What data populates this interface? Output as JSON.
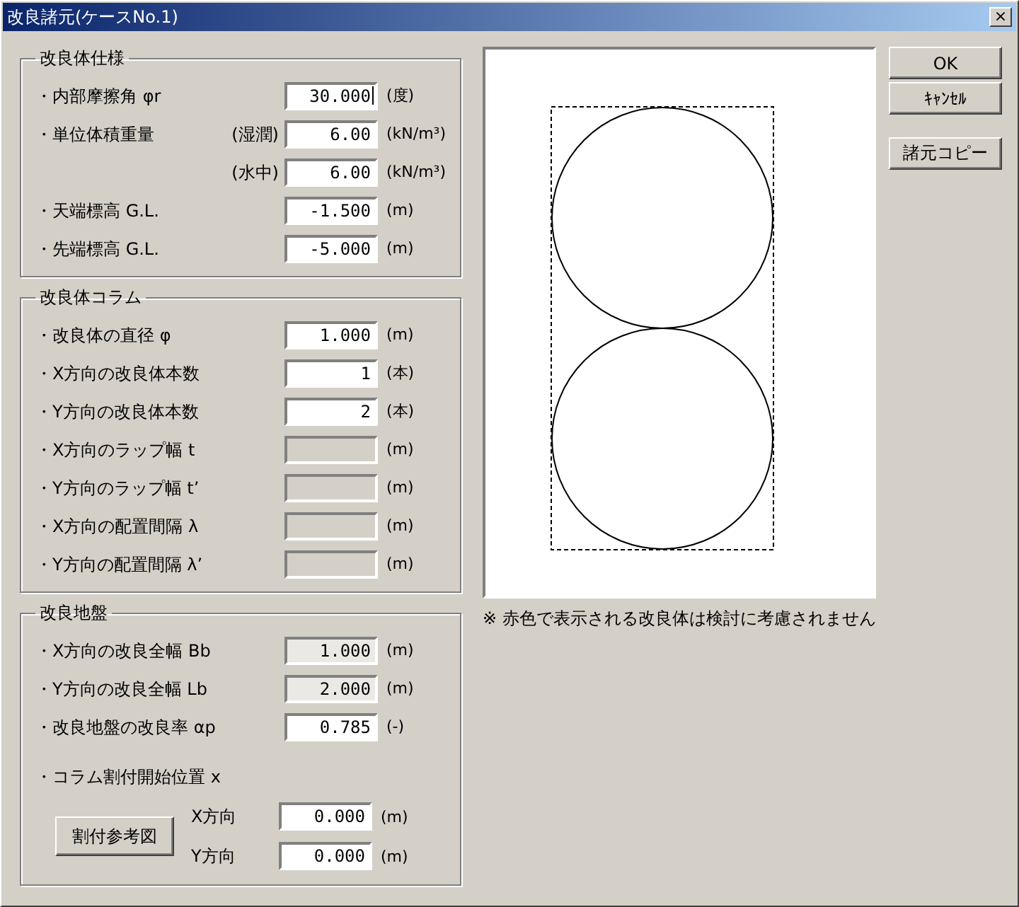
{
  "window": {
    "title": "改良諸元(ケースNo.1)",
    "close": "×"
  },
  "groups": [
    {
      "title": "改良体仕様",
      "rows": [
        {
          "label": "・内部摩擦角 φr",
          "sublabel": "",
          "value": "30.000",
          "unit": "(度)",
          "disabled": false,
          "readonly": false,
          "focused": true
        },
        {
          "label": "・単位体積重量",
          "sublabel": "(湿潤)",
          "value": "6.00",
          "unit": "(kN/m³)",
          "disabled": false,
          "readonly": false,
          "focused": false
        },
        {
          "label": "",
          "sublabel": "(水中)",
          "value": "6.00",
          "unit": "(kN/m³)",
          "disabled": false,
          "readonly": false,
          "focused": false
        },
        {
          "label": "・天端標高 G.L.",
          "sublabel": "",
          "value": "-1.500",
          "unit": "(m)",
          "disabled": false,
          "readonly": false,
          "focused": false
        },
        {
          "label": "・先端標高 G.L.",
          "sublabel": "",
          "value": "-5.000",
          "unit": "(m)",
          "disabled": false,
          "readonly": false,
          "focused": false
        }
      ]
    },
    {
      "title": "改良体コラム",
      "rows": [
        {
          "label": "・改良体の直径 φ",
          "sublabel": "",
          "value": "1.000",
          "unit": "(m)",
          "disabled": false,
          "readonly": false,
          "focused": false
        },
        {
          "label": "・X方向の改良体本数",
          "sublabel": "",
          "value": "1",
          "unit": "(本)",
          "disabled": false,
          "readonly": false,
          "focused": false
        },
        {
          "label": "・Y方向の改良体本数",
          "sublabel": "",
          "value": "2",
          "unit": "(本)",
          "disabled": false,
          "readonly": false,
          "focused": false
        },
        {
          "label": "・X方向のラップ幅 t",
          "sublabel": "",
          "value": "",
          "unit": "(m)",
          "disabled": true,
          "readonly": false,
          "focused": false
        },
        {
          "label": "・Y方向のラップ幅 t’",
          "sublabel": "",
          "value": "",
          "unit": "(m)",
          "disabled": true,
          "readonly": false,
          "focused": false
        },
        {
          "label": "・X方向の配置間隔 λ",
          "sublabel": "",
          "value": "",
          "unit": "(m)",
          "disabled": true,
          "readonly": false,
          "focused": false
        },
        {
          "label": "・Y方向の配置間隔 λ’",
          "sublabel": "",
          "value": "",
          "unit": "(m)",
          "disabled": true,
          "readonly": false,
          "focused": false
        }
      ]
    },
    {
      "title": "改良地盤",
      "rows": [
        {
          "label": "・X方向の改良全幅 Bb",
          "sublabel": "",
          "value": "1.000",
          "unit": "(m)",
          "disabled": false,
          "readonly": true,
          "focused": false
        },
        {
          "label": "・Y方向の改良全幅 Lb",
          "sublabel": "",
          "value": "2.000",
          "unit": "(m)",
          "disabled": false,
          "readonly": true,
          "focused": false
        },
        {
          "label": "・改良地盤の改良率 αp",
          "sublabel": "",
          "value": "0.785",
          "unit": "(-)",
          "disabled": false,
          "readonly": false,
          "focused": false
        }
      ],
      "start_label": "・コラム割付開始位置 x",
      "reference_button": "割付参考図",
      "directions": [
        {
          "label": "X方向",
          "value": "0.000",
          "unit": "(m)"
        },
        {
          "label": "Y方向",
          "value": "0.000",
          "unit": "(m)"
        }
      ]
    }
  ],
  "note": "※ 赤色で表示される改良体は検討に考慮されません",
  "buttons": [
    "OK",
    "ｷｬﾝｾﾙ"
  ],
  "copy_button": "諸元コピー"
}
